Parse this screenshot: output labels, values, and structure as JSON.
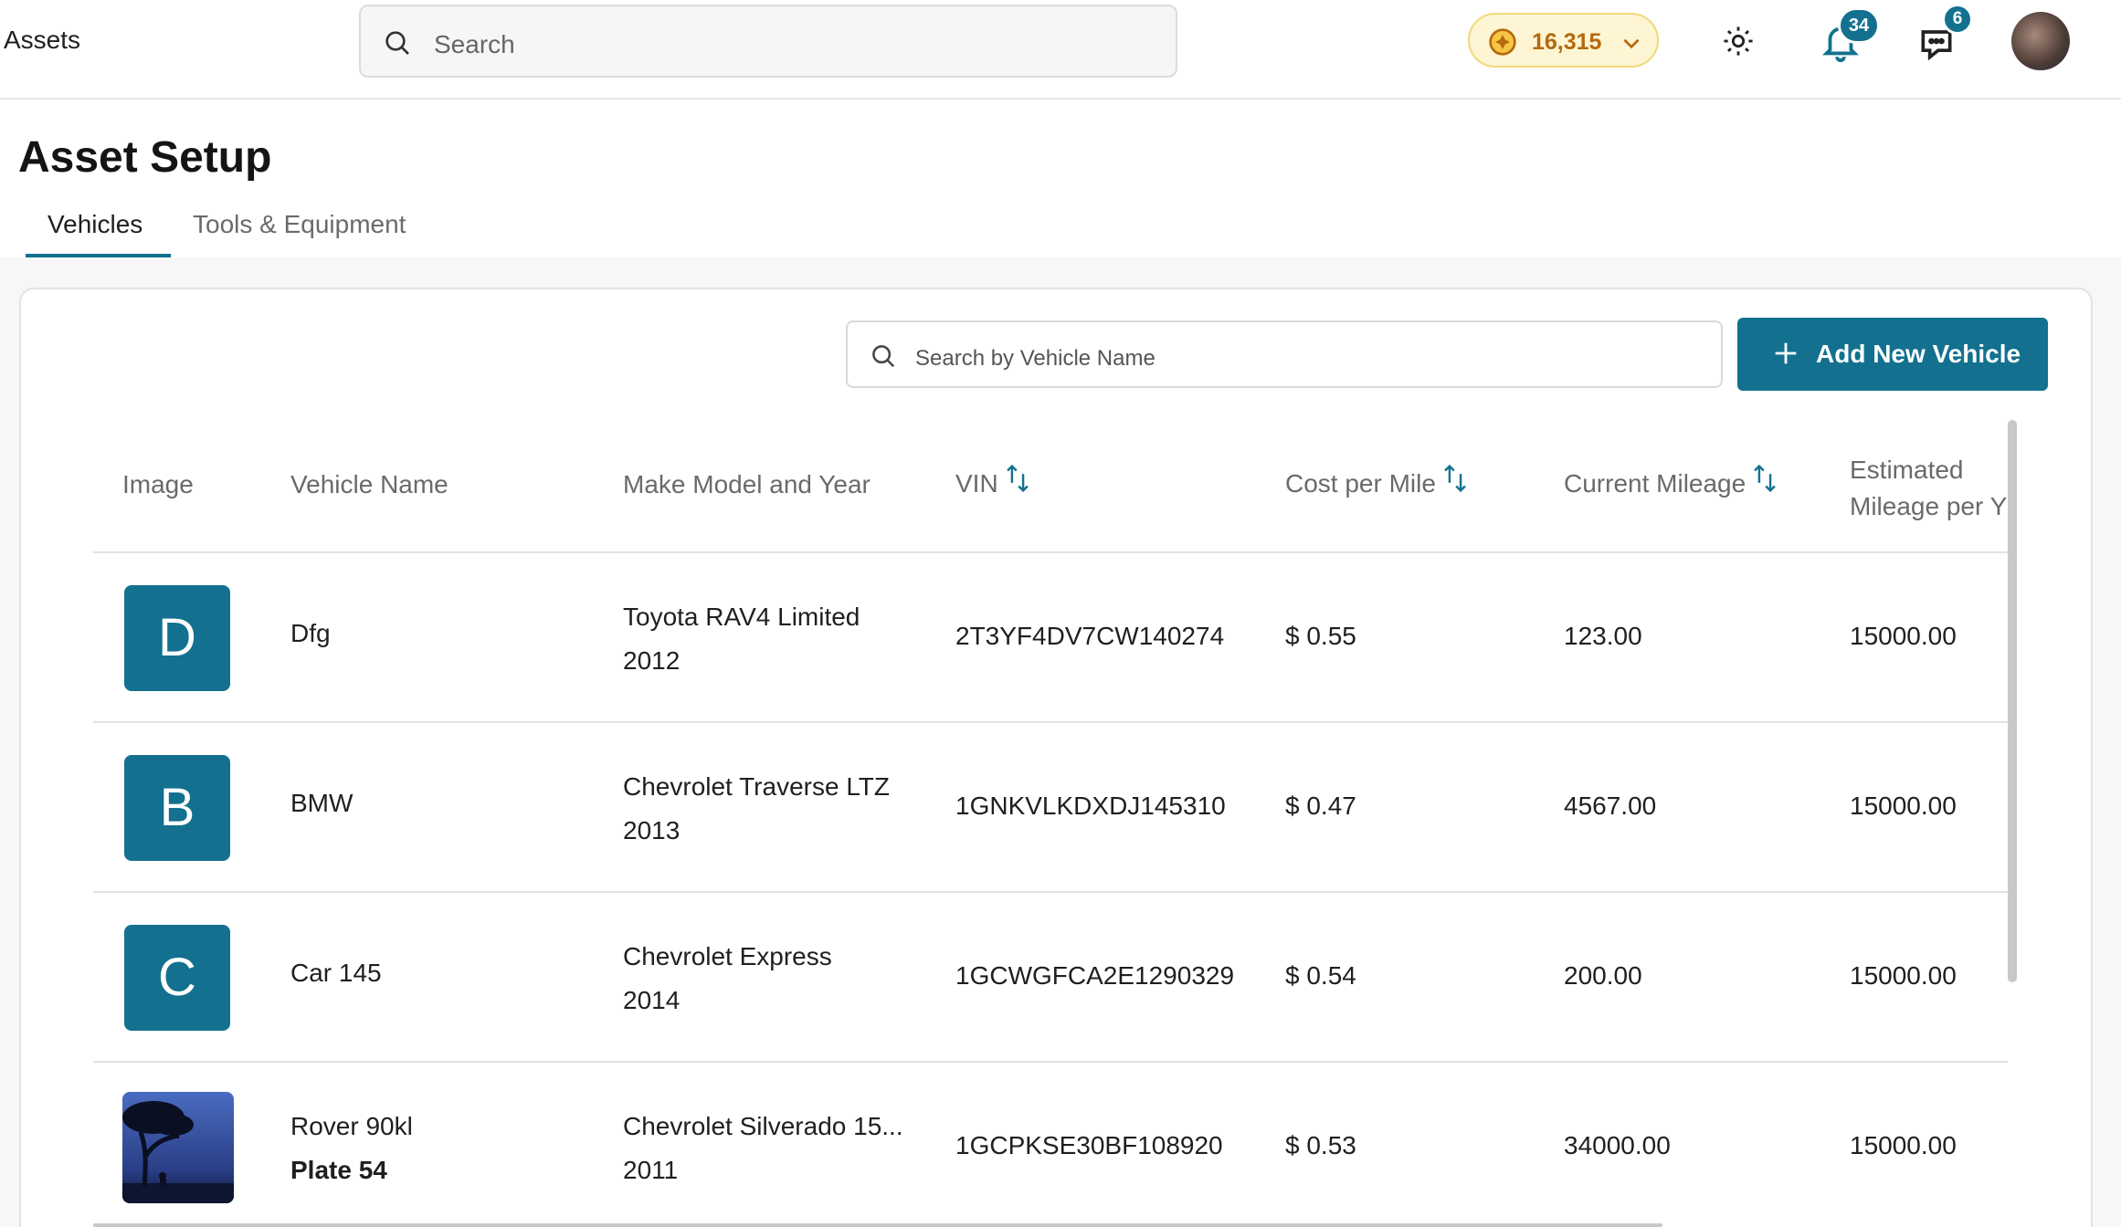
{
  "topbar": {
    "app_title": "Assets",
    "search_placeholder": "Search",
    "points_value": "16,315",
    "notifications_count": "34",
    "messages_count": "6"
  },
  "page": {
    "title": "Asset Setup",
    "tabs": [
      {
        "label": "Vehicles",
        "active": true
      },
      {
        "label": "Tools & Equipment",
        "active": false
      }
    ]
  },
  "toolbar": {
    "search_placeholder": "Search by Vehicle Name",
    "add_label": "Add New Vehicle"
  },
  "table": {
    "columns": {
      "image": "Image",
      "name": "Vehicle Name",
      "make": "Make Model and Year",
      "vin": "VIN",
      "cost": "Cost per Mile",
      "mileage": "Current Mileage",
      "est_line1": "Estimated",
      "est_line2": "Mileage per Y"
    },
    "rows": [
      {
        "initial": "D",
        "name": "Dfg",
        "name2": "",
        "make": "Toyota RAV4 Limited",
        "year": "2012",
        "vin": "2T3YF4DV7CW140274",
        "cost": "$ 0.55",
        "mileage": "123.00",
        "est": "15000.00"
      },
      {
        "initial": "B",
        "name": "BMW",
        "name2": "",
        "make": "Chevrolet Traverse LTZ",
        "year": "2013",
        "vin": "1GNKVLKDXDJ145310",
        "cost": "$ 0.47",
        "mileage": "4567.00",
        "est": "15000.00"
      },
      {
        "initial": "C",
        "name": "Car 145",
        "name2": "",
        "make": "Chevrolet Express",
        "year": "2014",
        "vin": "1GCWGFCA2E1290329",
        "cost": "$ 0.54",
        "mileage": "200.00",
        "est": "15000.00"
      },
      {
        "initial": "",
        "name": "Rover 90kl",
        "name2": "Plate 54",
        "make": "Chevrolet Silverado 15...",
        "year": "2011",
        "vin": "1GCPKSE30BF108920",
        "cost": "$ 0.53",
        "mileage": "34000.00",
        "est": "15000.00"
      }
    ]
  },
  "colors": {
    "accent": "#13718f",
    "points_bg": "#fdf5d3",
    "points_text": "#b4690e"
  }
}
